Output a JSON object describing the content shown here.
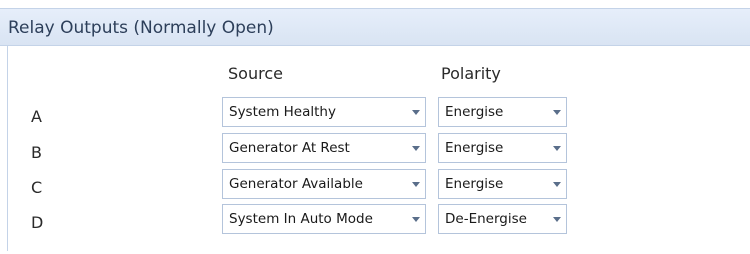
{
  "panel": {
    "title": "Relay Outputs (Normally Open)"
  },
  "columns": {
    "source": "Source",
    "polarity": "Polarity"
  },
  "rows": [
    {
      "label": "A",
      "source": "System Healthy",
      "polarity": "Energise"
    },
    {
      "label": "B",
      "source": "Generator At Rest",
      "polarity": "Energise"
    },
    {
      "label": "C",
      "source": "Generator Available",
      "polarity": "Energise"
    },
    {
      "label": "D",
      "source": "System In Auto Mode",
      "polarity": "De-Energise"
    }
  ],
  "icons": {
    "dropdown": "chevron-down-icon"
  },
  "colors": {
    "title_bar": "#dde7f5",
    "border": "#b4c4db",
    "title_text": "#2d3f5a"
  }
}
